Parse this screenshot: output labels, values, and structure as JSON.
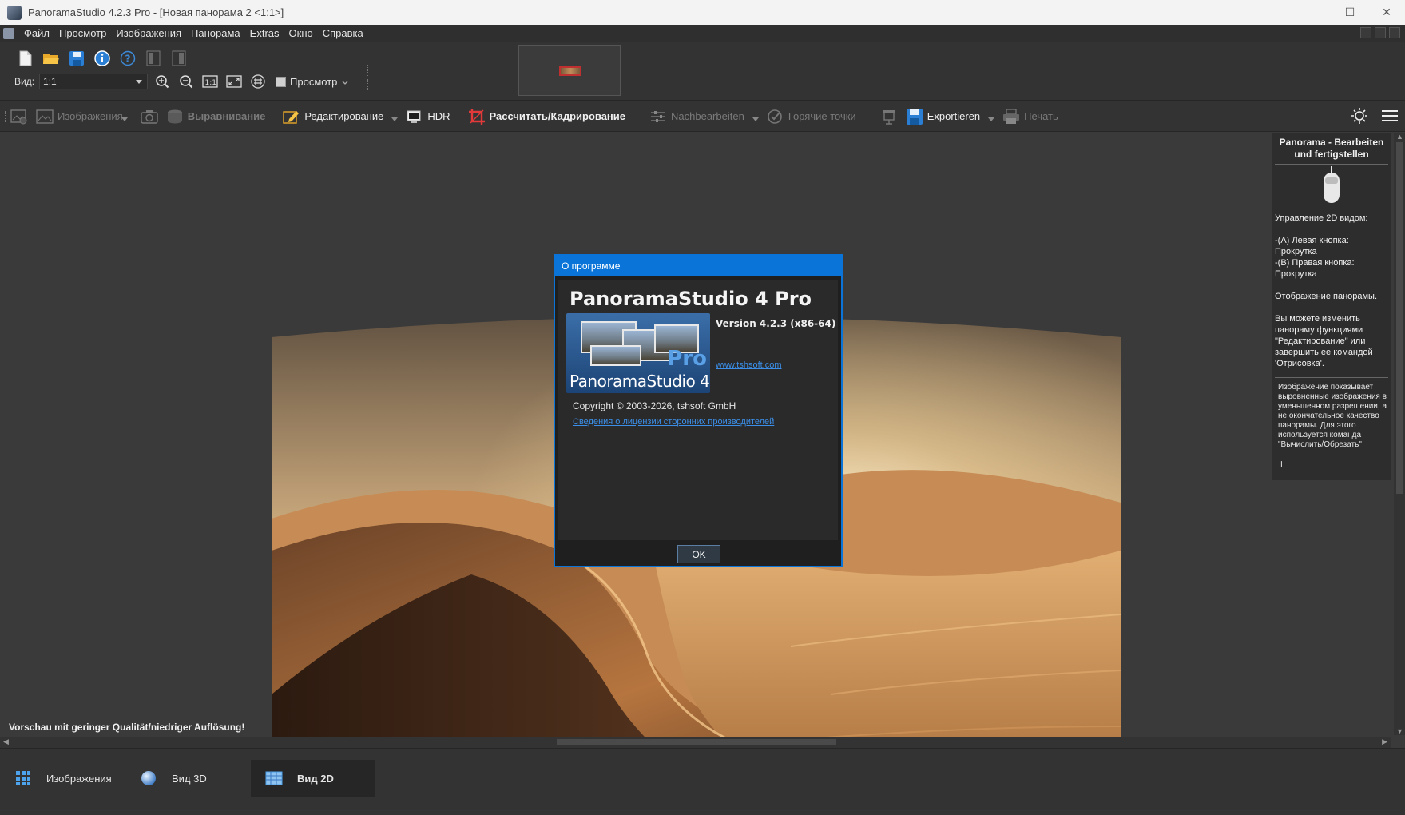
{
  "window": {
    "title": "PanoramaStudio 4.2.3 Pro - [Новая панорама 2 <1:1>]"
  },
  "menu": [
    "Файл",
    "Просмотр",
    "Изображения",
    "Панорама",
    "Extras",
    "Окно",
    "Справка"
  ],
  "toolbar": {
    "view_label": "Вид:",
    "zoom_value": "1:1",
    "preview_label": "Просмотр"
  },
  "workflow": {
    "images": "Изображения",
    "align": "Выравнивание",
    "edit": "Редактирование",
    "hdr": "HDR",
    "render": "Рассчитать/Кадрирование",
    "postprocess": "Nachbearbeiten",
    "hotspots": "Горячие точки",
    "export": "Exportieren",
    "print": "Печать"
  },
  "canvas": {
    "low_quality_notice": "Vorschau mit geringer Qualität/niedriger Auflösung!"
  },
  "info_panel": {
    "title": "Panorama - Bearbeiten und fertigstellen",
    "p1": "Управление 2D видом:",
    "p2": "-(A) Левая кнопка: Прокрутка\n-(B) Правая кнопка: Прокрутка",
    "p3": "Отображение панорамы.",
    "p4": "Вы можете изменить панораму функциями \"Редактирование\" или завершить ее командой 'Отрисовка'.",
    "note": "Изображение показывает выровненные изображения в уменьшенном разрешении, а не окончательное качество панорамы. Для этого используется команда \"Вычислить/Обрезать\"",
    "mouse_a": "A",
    "mouse_b": "B"
  },
  "dialog": {
    "title": "О программе",
    "product": "PanoramaStudio 4 Pro",
    "version": "Version 4.2.3 (x86-64)",
    "logo_pro": "Pro",
    "logo_name": "PanoramaStudio 4",
    "website": "www.tshsoft.com",
    "copyright": "Copyright © 2003-2026, tshsoft GmbH",
    "license_link": "Сведения о лицензии сторонних производителей",
    "ok": "OK"
  },
  "tabs": {
    "images": "Изображения",
    "view3d": "Вид 3D",
    "view2d": "Вид 2D"
  },
  "colors": {
    "accent": "#0a74d8",
    "link": "#3b8fe8",
    "background": "#3a3a3a"
  }
}
